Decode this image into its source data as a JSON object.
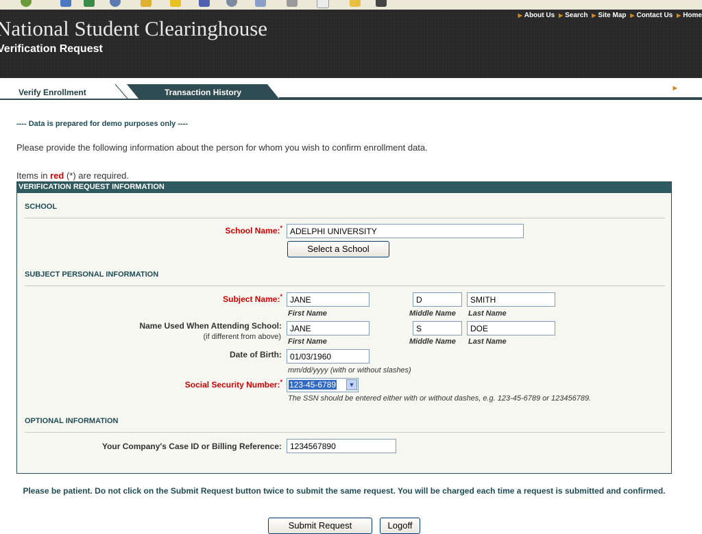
{
  "header": {
    "site_title": "National Student Clearinghouse",
    "subtitle": "Verification Request",
    "top_links": [
      "About Us",
      "Search",
      "Site Map",
      "Contact Us",
      "Home"
    ]
  },
  "tabs": [
    {
      "label": "Verify Enrollment",
      "active": true
    },
    {
      "label": "Transaction History",
      "active": false
    }
  ],
  "logoff_link": "Logoff",
  "demo_note": "---- Data is prepared for demo purposes only ----",
  "intro": "Please provide the following information about the person for whom you wish to confirm enrollment data.",
  "required_note": {
    "prefix": "Items in ",
    "red": "red",
    "suffix": " (*) are required."
  },
  "form": {
    "title": "VERIFICATION REQUEST INFORMATION",
    "school_section": "SCHOOL",
    "school_name_label": "School Name:",
    "school_name_value": "ADELPHI UNIVERSITY",
    "select_school_button": "Select a School",
    "personal_section": "SUBJECT PERSONAL INFORMATION",
    "subject_name_label": "Subject Name:",
    "subject_first": "JANE",
    "subject_middle": "D",
    "subject_last": "SMITH",
    "first_name_hint": "First Name",
    "middle_name_hint": "Middle Name",
    "last_name_hint": "Last Name",
    "school_name_used_label": "Name Used When Attending School:",
    "school_name_used_sub": "(if different from above)",
    "used_first": "JANE",
    "used_middle": "S",
    "used_last": "DOE",
    "dob_label": "Date of Birth:",
    "dob_value": "01/03/1960",
    "dob_hint": "mm/dd/yyyy (with or without slashes)",
    "ssn_label": "Social Security Number:",
    "ssn_value": "123-45-6789",
    "ssn_hint": "The SSN should be entered either with or without dashes, e.g. 123-45-6789 or 123456789.",
    "optional_section": "OPTIONAL INFORMATION",
    "case_id_label": "Your Company's Case ID or Billing Reference:",
    "case_id_value": "1234567890"
  },
  "patience_note": "Please be patient. Do not click on the Submit Request button twice to submit the same request. You will be charged each time a request is submitted and confirmed.",
  "submit_button": "Submit Request",
  "logoff_button": "Logoff",
  "colors": {
    "header_bg": "#2a2a2a",
    "teal": "#2f5a5f",
    "required_red": "#cc0000",
    "accent_arrow": "#d08a20"
  }
}
